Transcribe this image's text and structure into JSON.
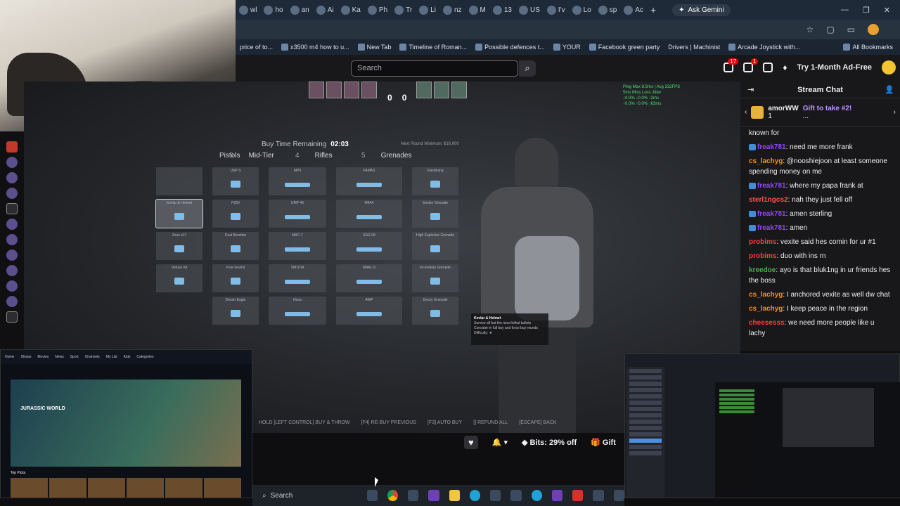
{
  "browser": {
    "tabs": [
      "wl",
      "ho",
      "an",
      "Ai",
      "Ka",
      "Ph",
      "Tr",
      "Li",
      "nz",
      "M",
      "13",
      "US",
      "I'v",
      "Lo",
      "sp",
      "Ac"
    ],
    "new_tab_symbol": "+",
    "gemini_label": "Ask Gemini",
    "bookmarks": [
      "price of to...",
      "x3500 m4 how to u...",
      "New Tab",
      "Timeline of Roman...",
      "Possible defences t...",
      "YOUR",
      "Facebook green party",
      "Drivers | Machinist",
      "Arcade Joystick with..."
    ],
    "all_bookmarks": "All Bookmarks"
  },
  "twitch": {
    "search_placeholder": "Search",
    "notif_count_1": "17",
    "notif_count_2": "1",
    "ad_free_label": "Try 1-Month Ad-Free",
    "controls": {
      "bits_label": "Bits: 29% off",
      "gift_label": "Gift"
    }
  },
  "game": {
    "buy_time_label": "Buy Time Remaining",
    "buy_time_value": "02:03",
    "min_round": "Next Round Minimum: $16,000",
    "score_t": "0",
    "score_ct": "0",
    "categories": [
      {
        "num": "",
        "label": "Pistols"
      },
      {
        "num": "3",
        "label": "Mid-Tier"
      },
      {
        "num": "4",
        "label": "Rifles"
      },
      {
        "num": "5",
        "label": "Grenades"
      }
    ],
    "items": [
      [
        "",
        "USP-S",
        "MP9",
        "FAMAS",
        "Flashbang"
      ],
      [
        "Kevlar & Helmet",
        "P250",
        "UMP-45",
        "M4A4",
        "Smoke Grenade"
      ],
      [
        "Zeus x27",
        "Dual Berettas",
        "MAC-7",
        "SSG 08",
        "High Explosive Grenade"
      ],
      [
        "Defuse Kit",
        "Five-SeveN",
        "XM1014",
        "M4A1-S",
        "Incendiary Grenade"
      ],
      [
        "",
        "Desert Eagle",
        "Nova",
        "AWP",
        "Decoy Grenade"
      ]
    ],
    "hotkeys": [
      "HOLD [LEFT CONTROL] BUY & THROW",
      "[F4] RE-BUY PREVIOUS",
      "[F3] AUTO BUY",
      "[] REFUND ALL",
      "[ESCAPE] BACK"
    ],
    "tooltip_title": "Kevlar & Helmet",
    "tooltip_lines": [
      "Survive all but the most lethal bullets",
      "Consider in full buy and force buy rounds",
      "Difficulty: ★"
    ],
    "net_stats": [
      "Ping  Max  8.9ms | Avg  332FPS",
      "5ms   Miss   Loss   Jitter",
      "      ↓0.0%  ↓0.0%  ↓2ms",
      "      ↑0.0%  ↑0.0%  ↑63ms"
    ]
  },
  "chat": {
    "title": "Stream Chat",
    "gift_user": "amorWW",
    "gift_count": "1",
    "gift_text": "Gift to take #2!",
    "gift_more": "...",
    "messages": [
      {
        "user": "",
        "text": "known for",
        "color": "#efeff1"
      },
      {
        "user": "freak781",
        "text": ": need me more frank",
        "color": "#9146ff",
        "sub": true
      },
      {
        "user": "cs_lachyg",
        "text": ": @nooshiejoon at least someone spending money on me",
        "color": "#ff8c1a"
      },
      {
        "user": "freak781",
        "text": ": where my papa frank at",
        "color": "#9146ff",
        "sub": true
      },
      {
        "user": "sterl1ngcs2",
        "text": ": nah they just fell off",
        "color": "#ff4f4f"
      },
      {
        "user": "freak781",
        "text": ": amen sterling",
        "color": "#9146ff",
        "sub": true
      },
      {
        "user": "freak781",
        "text": ": amen",
        "color": "#9146ff",
        "sub": true
      },
      {
        "user": "probims",
        "text": ": vexite said hes comin for ur #1",
        "color": "#ff3b3b"
      },
      {
        "user": "probims",
        "text": ": duo with ins rn",
        "color": "#ff3b3b"
      },
      {
        "user": "kreedoe",
        "text": ": ayo is that bluk1ng in ur friends hes the boss",
        "color": "#4caf50"
      },
      {
        "user": "cs_lachyg",
        "text": ": I anchored vexite as well dw chat",
        "color": "#ff8c1a"
      },
      {
        "user": "cs_lachyg",
        "text": ": I keep peace in the region",
        "color": "#ff8c1a"
      },
      {
        "user": "cheesesss",
        "text": ": we need more people like u lachy",
        "color": "#ff3b3b"
      }
    ]
  },
  "overlay_left": {
    "nav": [
      "Home",
      "Shows",
      "Movies",
      "News",
      "Sport",
      "Channels",
      "My List",
      "Kids",
      "Categories"
    ],
    "hero_title": "JURASSIC WORLD",
    "top_picks": "Top Picks"
  },
  "taskbar": {
    "search_label": "Search"
  }
}
